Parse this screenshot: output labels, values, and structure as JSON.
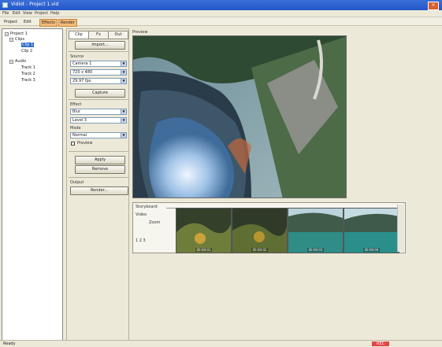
{
  "window": {
    "title": "Vidiot - Project 1.vid"
  },
  "menu": [
    "File",
    "Edit",
    "View",
    "Project",
    "Help"
  ],
  "toolbar": [
    {
      "label": "Project",
      "active": false
    },
    {
      "label": "Edit",
      "active": false
    },
    {
      "label": "Effects",
      "active": true
    },
    {
      "label": "Render",
      "active": true
    }
  ],
  "tree": {
    "nodes": [
      {
        "label": "Project 1",
        "level": 0,
        "expanded": true
      },
      {
        "label": "Clips",
        "level": 1,
        "expanded": true
      },
      {
        "label": "Clip 1",
        "level": 2,
        "selected": true
      },
      {
        "label": "Clip 2",
        "level": 2
      },
      {
        "label": "Audio",
        "level": 1,
        "expanded": true
      },
      {
        "label": "Track 1",
        "level": 2
      },
      {
        "label": "Track 2",
        "level": 2
      },
      {
        "label": "Track 3",
        "level": 2
      }
    ]
  },
  "panel": {
    "tabs": [
      "Clip",
      "Fx",
      "Out"
    ],
    "b1": "Import...",
    "l1": "Source",
    "s1": "Camera 1",
    "s2": "720 x 480",
    "s3": "29.97 fps",
    "b2": "Capture",
    "l2": "Effect",
    "s4": "Blur",
    "s5": "Level 3",
    "l3": "Mode",
    "s6": "Normal",
    "chk": "Preview",
    "b3": "Apply",
    "b4": "Remove",
    "l4": "Output",
    "b5": "Render..."
  },
  "preview": {
    "label": "Preview"
  },
  "timeline": {
    "title": "Storyboard",
    "row1": "Video",
    "row2": "Zoom",
    "row3": "1 2 3",
    "frames": [
      {
        "caption": "00:00:01"
      },
      {
        "caption": "00:00:02"
      },
      {
        "caption": "00:00:03"
      },
      {
        "caption": "00:00:04"
      }
    ]
  },
  "status": {
    "left": "Ready",
    "right": "REC"
  }
}
